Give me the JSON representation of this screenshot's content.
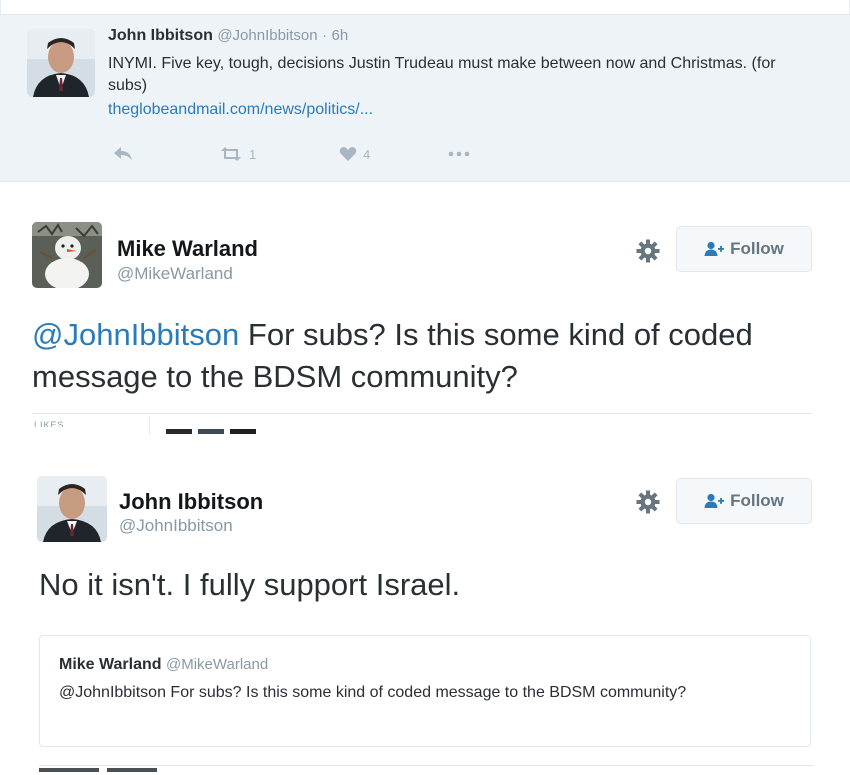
{
  "tweet_1": {
    "author_name": "John Ibbitson",
    "author_handle": "@JohnIbbitson",
    "time": "6h",
    "separator": "·",
    "text": "INYMI. Five key, tough, decisions Justin Trudeau must make between now and Christmas. (for subs)",
    "link": "theglobeandmail.com/news/politics/...",
    "retweet_count": "1",
    "like_count": "4"
  },
  "tweet_2": {
    "author_name": "Mike Warland",
    "author_handle": "@MikeWarland",
    "follow_label": "Follow",
    "mention": "@JohnIbbitson",
    "text": " For subs? Is this some kind of coded message to the BDSM community?",
    "likes_label": "LIKES"
  },
  "tweet_3": {
    "author_name": "John Ibbitson",
    "author_handle": "@JohnIbbitson",
    "follow_label": "Follow",
    "text": "No it isn't. I fully support Israel.",
    "quoted": {
      "author_name": "Mike Warland",
      "author_handle": "@MikeWarland",
      "text": "@JohnIbbitson For subs? Is this some kind of coded message to the BDSM community?"
    }
  },
  "colors": {
    "highlight_bg": "#eef3f7",
    "link": "#2b7bb9",
    "muted": "#8899a6",
    "button_bg": "#f5f8fa"
  },
  "icons": [
    "reply-icon",
    "retweet-icon",
    "heart-icon",
    "more-icon",
    "gear-icon",
    "follow-person-icon"
  ]
}
